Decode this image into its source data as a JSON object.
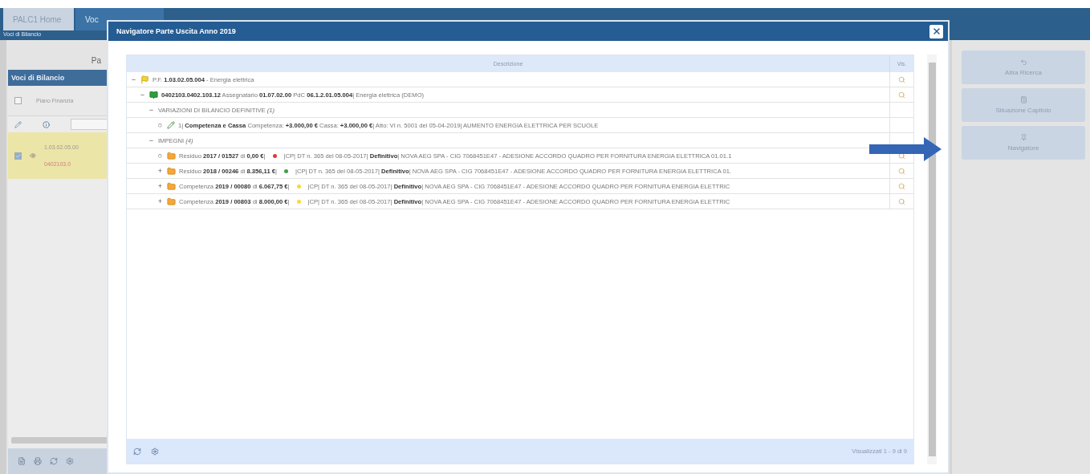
{
  "app_tabs": [
    {
      "label": "PALC1 Home",
      "selected": false
    },
    {
      "label": "Voc",
      "selected": true
    }
  ],
  "breadcrumb": "Voci di Bilancio",
  "left": {
    "heading_fragment": "Pa",
    "panel_title": "Voci di Bilancio",
    "select_all": {
      "checked": false
    },
    "column": "Piano Finanzia",
    "row": {
      "selected": true,
      "checked": true,
      "code": "1.03.02.05.00",
      "subcode": "0402103.0"
    }
  },
  "actions": [
    {
      "label": "Altra Ricerca"
    },
    {
      "label": "Situazione Capitolo"
    },
    {
      "label": "Navigatore"
    }
  ],
  "modal": {
    "title": "Navigatore Parte Uscita Anno 2019",
    "columns": [
      "Descrizione",
      "Vis."
    ],
    "tree": [
      {
        "toggle": "−",
        "kind": "flag",
        "text": "P.F. **1.03.02.05.004** - Energia elettrica",
        "vis": true,
        "children": [
          {
            "toggle": "−",
            "kind": "ledger",
            "text": "**0402103.0402.103.12** Assegnatario **01.07.02.00** PdC **06.1.2.01.05.004**| Energia elettrica (DEMO)",
            "vis": true,
            "children": [
              {
                "toggle": "−",
                "text": "VARIAZIONI DI BILANCIO DEFINITIVE *(1)*",
                "vis": false,
                "children": [
                  {
                    "toggle": "○",
                    "kind": "pencil",
                    "text": "1| **Competenza e Cassa** Competenza: **+3.000,00 €** Cassa: **+3.000,00 €**| Atto: VI n. 5001 del 05-04-2019| AUMENTO ENERGIA ELETTRICA PER SCUOLE",
                    "vis": false
                  }
                ]
              },
              {
                "toggle": "−",
                "text": "IMPEGNI *(4)*",
                "vis": false,
                "children": [
                  {
                    "toggle": "○",
                    "kind": "folder",
                    "text": "Residuo **2017 / 01527** di **0,00 €**|",
                    "color": "#e53935",
                    "detail": "|CP| DT n. 365 del 08-05-2017| **Definitivo**| NOVA AEG SPA - CIG 7068451E47 - ADESIONE ACCORDO QUADRO PER FORNITURA ENERGIA ELETTRICA 01.01.1",
                    "vis": true
                  },
                  {
                    "toggle": "+",
                    "kind": "folder",
                    "text": "Residuo **2018 / 00246** di **8.356,11 €**|",
                    "color": "#43a047",
                    "detail": "|CP| DT n. 365 del 08-05-2017| **Definitivo**| NOVA AEG SPA - CIG 7068451E47 - ADESIONE ACCORDO QUADRO PER FORNITURA ENERGIA ELETTRICA 01.",
                    "vis": true
                  },
                  {
                    "toggle": "+",
                    "kind": "folder",
                    "text": "Competenza **2019 / 00080** di **6.067,75 €**|",
                    "color": "#fdd835",
                    "detail": "|CP| DT n. 365 del 08-05-2017| **Definitivo**| NOVA AEG SPA - CIG 7068451E47 - ADESIONE ACCORDO QUADRO PER FORNITURA ENERGIA ELETTRIC",
                    "vis": true
                  },
                  {
                    "toggle": "+",
                    "kind": "folder",
                    "text": "Competenza **2019 / 00803** di **8.000,00 €**|",
                    "color": "#fdd835",
                    "detail": "|CP| DT n. 365 del 08-05-2017| **Definitivo**| NOVA AEG SPA - CIG 7068451E47 - ADESIONE ACCORDO QUADRO PER FORNITURA ENERGIA ELETTRIC",
                    "vis": true
                  }
                ]
              }
            ]
          }
        ]
      }
    ],
    "pager": "Visualizzati 1 - 9 di 9"
  }
}
